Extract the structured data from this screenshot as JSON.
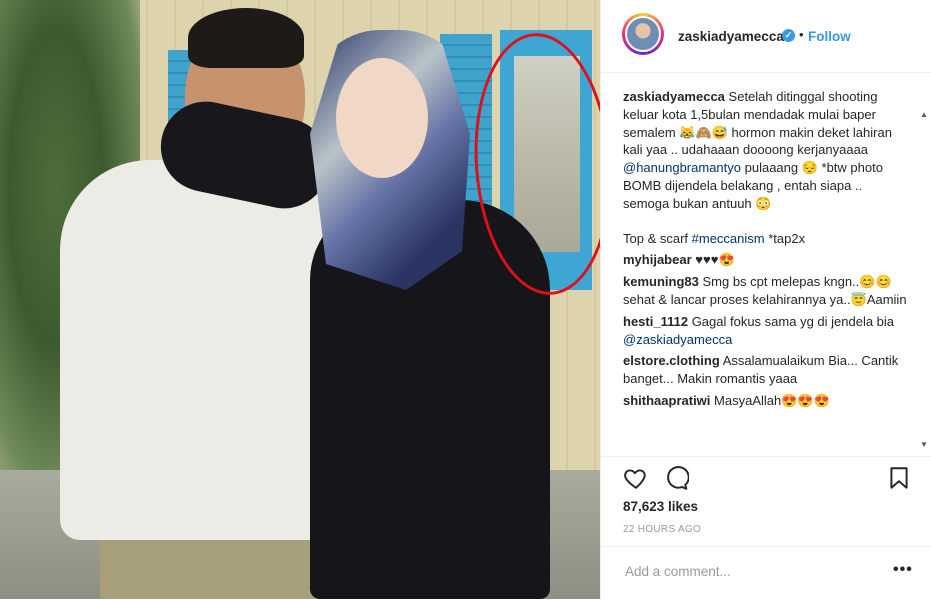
{
  "post": {
    "username": "zaskiadyamecca",
    "verified_mark": "✓",
    "dot": "•",
    "follow_label": "Follow",
    "caption": {
      "line1": "Setelah ditinggal shooting keluar kota 1,5bulan mendadak mulai baper semalem 😹🙈😅 hormon makin deket lahiran kali yaa .. udahaaan doooong kerjanyaaaa",
      "mention": "@hanungbramantyo",
      "line2": " pulaaang 😔 *btw photo BOMB dijendela belakang , entah siapa .. semoga bukan antuuh 😳",
      "line3_prefix": "Top & scarf ",
      "hashtag": "#meccanism",
      "line3_suffix": " *tap2x"
    },
    "comments": [
      {
        "user": "myhijabear",
        "text": "♥♥♥😍"
      },
      {
        "user": "kemuning83",
        "text": "Smg bs cpt melepas kngn..😊😊sehat & lancar proses kelahirannya ya..😇Aamiin"
      },
      {
        "user": "hesti_1112",
        "text": "Gagal fokus sama yg di jendela bia ",
        "mention": "@zaskiadyamecca"
      },
      {
        "user": "elstore.clothing",
        "text": "Assalamualaikum Bia... Cantik banget... Makin romantis yaaa"
      },
      {
        "user": "shithaapratiwi",
        "text": "MasyaAllah😍😍😍"
      }
    ],
    "likes": "87,623 likes",
    "time": "22 HOURS AGO",
    "add_comment_placeholder": "Add a comment...",
    "more_label": "•••",
    "icons": {
      "like": "heart-icon",
      "comment": "comment-bubble-icon",
      "save": "bookmark-icon"
    }
  },
  "colors": {
    "accent": "#3897f0",
    "annotation": "#e10f17",
    "link": "#003569"
  }
}
